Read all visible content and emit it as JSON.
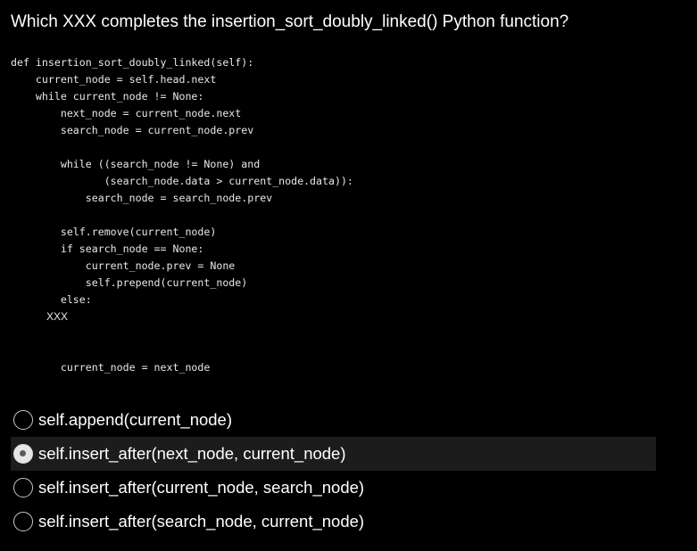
{
  "question": "Which XXX completes the insertion_sort_doubly_linked() Python function?",
  "code_lines": [
    "def insertion_sort_doubly_linked(self):",
    "    current_node = self.head.next",
    "    while current_node != None:",
    "        next_node = current_node.next",
    "        search_node = current_node.prev",
    "",
    "        while ((search_node != None) and",
    "               (search_node.data > current_node.data)):",
    "            search_node = search_node.prev",
    "",
    "        self.remove(current_node)",
    "        if search_node == None:",
    "            current_node.prev = None",
    "            self.prepend(current_node)",
    "        else:",
    "            XXX",
    "",
    "",
    "        current_node = next_node"
  ],
  "options": [
    {
      "label": "self.append(current_node)",
      "selected": false
    },
    {
      "label": "self.insert_after(next_node, current_node)",
      "selected": true
    },
    {
      "label": "self.insert_after(current_node, search_node)",
      "selected": false
    },
    {
      "label": "self.insert_after(search_node, current_node)",
      "selected": false
    }
  ]
}
